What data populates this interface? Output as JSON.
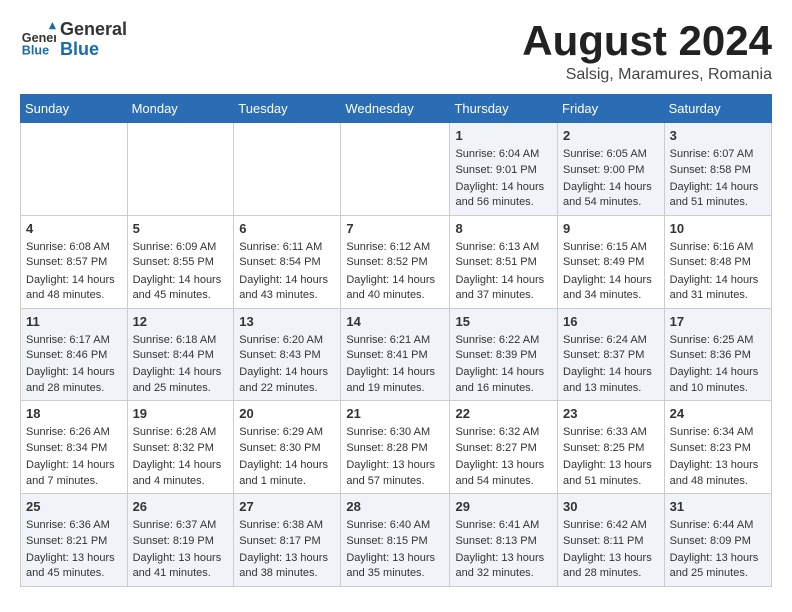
{
  "header": {
    "logo_general": "General",
    "logo_blue": "Blue",
    "month_year": "August 2024",
    "location": "Salsig, Maramures, Romania"
  },
  "days_of_week": [
    "Sunday",
    "Monday",
    "Tuesday",
    "Wednesday",
    "Thursday",
    "Friday",
    "Saturday"
  ],
  "weeks": [
    [
      {
        "day": "",
        "info": ""
      },
      {
        "day": "",
        "info": ""
      },
      {
        "day": "",
        "info": ""
      },
      {
        "day": "",
        "info": ""
      },
      {
        "day": "1",
        "sunrise": "Sunrise: 6:04 AM",
        "sunset": "Sunset: 9:01 PM",
        "daylight": "Daylight: 14 hours and 56 minutes."
      },
      {
        "day": "2",
        "sunrise": "Sunrise: 6:05 AM",
        "sunset": "Sunset: 9:00 PM",
        "daylight": "Daylight: 14 hours and 54 minutes."
      },
      {
        "day": "3",
        "sunrise": "Sunrise: 6:07 AM",
        "sunset": "Sunset: 8:58 PM",
        "daylight": "Daylight: 14 hours and 51 minutes."
      }
    ],
    [
      {
        "day": "4",
        "sunrise": "Sunrise: 6:08 AM",
        "sunset": "Sunset: 8:57 PM",
        "daylight": "Daylight: 14 hours and 48 minutes."
      },
      {
        "day": "5",
        "sunrise": "Sunrise: 6:09 AM",
        "sunset": "Sunset: 8:55 PM",
        "daylight": "Daylight: 14 hours and 45 minutes."
      },
      {
        "day": "6",
        "sunrise": "Sunrise: 6:11 AM",
        "sunset": "Sunset: 8:54 PM",
        "daylight": "Daylight: 14 hours and 43 minutes."
      },
      {
        "day": "7",
        "sunrise": "Sunrise: 6:12 AM",
        "sunset": "Sunset: 8:52 PM",
        "daylight": "Daylight: 14 hours and 40 minutes."
      },
      {
        "day": "8",
        "sunrise": "Sunrise: 6:13 AM",
        "sunset": "Sunset: 8:51 PM",
        "daylight": "Daylight: 14 hours and 37 minutes."
      },
      {
        "day": "9",
        "sunrise": "Sunrise: 6:15 AM",
        "sunset": "Sunset: 8:49 PM",
        "daylight": "Daylight: 14 hours and 34 minutes."
      },
      {
        "day": "10",
        "sunrise": "Sunrise: 6:16 AM",
        "sunset": "Sunset: 8:48 PM",
        "daylight": "Daylight: 14 hours and 31 minutes."
      }
    ],
    [
      {
        "day": "11",
        "sunrise": "Sunrise: 6:17 AM",
        "sunset": "Sunset: 8:46 PM",
        "daylight": "Daylight: 14 hours and 28 minutes."
      },
      {
        "day": "12",
        "sunrise": "Sunrise: 6:18 AM",
        "sunset": "Sunset: 8:44 PM",
        "daylight": "Daylight: 14 hours and 25 minutes."
      },
      {
        "day": "13",
        "sunrise": "Sunrise: 6:20 AM",
        "sunset": "Sunset: 8:43 PM",
        "daylight": "Daylight: 14 hours and 22 minutes."
      },
      {
        "day": "14",
        "sunrise": "Sunrise: 6:21 AM",
        "sunset": "Sunset: 8:41 PM",
        "daylight": "Daylight: 14 hours and 19 minutes."
      },
      {
        "day": "15",
        "sunrise": "Sunrise: 6:22 AM",
        "sunset": "Sunset: 8:39 PM",
        "daylight": "Daylight: 14 hours and 16 minutes."
      },
      {
        "day": "16",
        "sunrise": "Sunrise: 6:24 AM",
        "sunset": "Sunset: 8:37 PM",
        "daylight": "Daylight: 14 hours and 13 minutes."
      },
      {
        "day": "17",
        "sunrise": "Sunrise: 6:25 AM",
        "sunset": "Sunset: 8:36 PM",
        "daylight": "Daylight: 14 hours and 10 minutes."
      }
    ],
    [
      {
        "day": "18",
        "sunrise": "Sunrise: 6:26 AM",
        "sunset": "Sunset: 8:34 PM",
        "daylight": "Daylight: 14 hours and 7 minutes."
      },
      {
        "day": "19",
        "sunrise": "Sunrise: 6:28 AM",
        "sunset": "Sunset: 8:32 PM",
        "daylight": "Daylight: 14 hours and 4 minutes."
      },
      {
        "day": "20",
        "sunrise": "Sunrise: 6:29 AM",
        "sunset": "Sunset: 8:30 PM",
        "daylight": "Daylight: 14 hours and 1 minute."
      },
      {
        "day": "21",
        "sunrise": "Sunrise: 6:30 AM",
        "sunset": "Sunset: 8:28 PM",
        "daylight": "Daylight: 13 hours and 57 minutes."
      },
      {
        "day": "22",
        "sunrise": "Sunrise: 6:32 AM",
        "sunset": "Sunset: 8:27 PM",
        "daylight": "Daylight: 13 hours and 54 minutes."
      },
      {
        "day": "23",
        "sunrise": "Sunrise: 6:33 AM",
        "sunset": "Sunset: 8:25 PM",
        "daylight": "Daylight: 13 hours and 51 minutes."
      },
      {
        "day": "24",
        "sunrise": "Sunrise: 6:34 AM",
        "sunset": "Sunset: 8:23 PM",
        "daylight": "Daylight: 13 hours and 48 minutes."
      }
    ],
    [
      {
        "day": "25",
        "sunrise": "Sunrise: 6:36 AM",
        "sunset": "Sunset: 8:21 PM",
        "daylight": "Daylight: 13 hours and 45 minutes."
      },
      {
        "day": "26",
        "sunrise": "Sunrise: 6:37 AM",
        "sunset": "Sunset: 8:19 PM",
        "daylight": "Daylight: 13 hours and 41 minutes."
      },
      {
        "day": "27",
        "sunrise": "Sunrise: 6:38 AM",
        "sunset": "Sunset: 8:17 PM",
        "daylight": "Daylight: 13 hours and 38 minutes."
      },
      {
        "day": "28",
        "sunrise": "Sunrise: 6:40 AM",
        "sunset": "Sunset: 8:15 PM",
        "daylight": "Daylight: 13 hours and 35 minutes."
      },
      {
        "day": "29",
        "sunrise": "Sunrise: 6:41 AM",
        "sunset": "Sunset: 8:13 PM",
        "daylight": "Daylight: 13 hours and 32 minutes."
      },
      {
        "day": "30",
        "sunrise": "Sunrise: 6:42 AM",
        "sunset": "Sunset: 8:11 PM",
        "daylight": "Daylight: 13 hours and 28 minutes."
      },
      {
        "day": "31",
        "sunrise": "Sunrise: 6:44 AM",
        "sunset": "Sunset: 8:09 PM",
        "daylight": "Daylight: 13 hours and 25 minutes."
      }
    ]
  ]
}
